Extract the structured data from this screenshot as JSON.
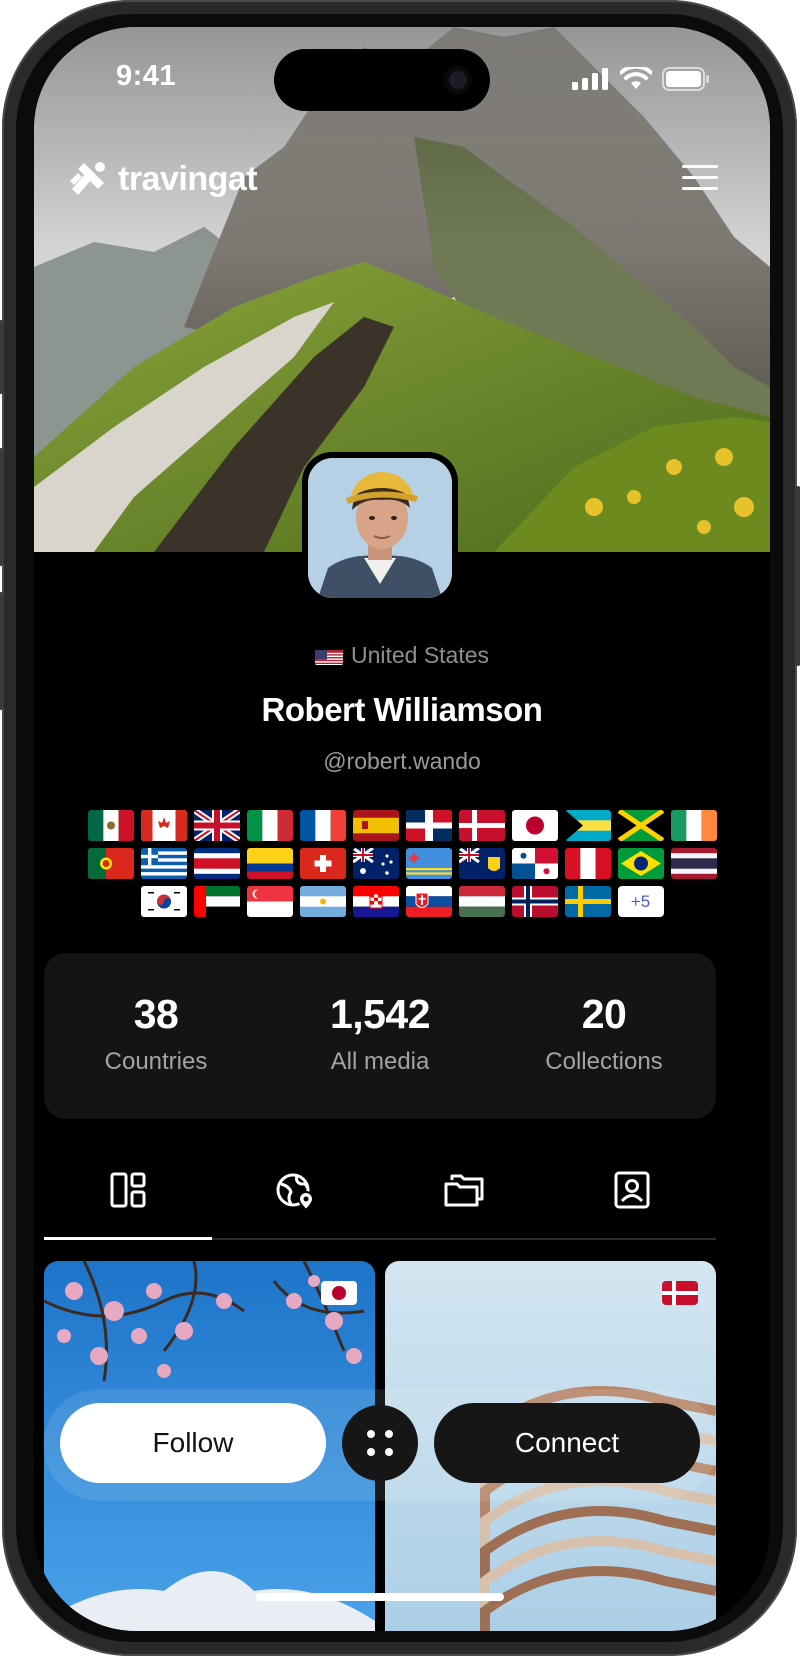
{
  "status_bar": {
    "time": "9:41"
  },
  "brand": {
    "name": "travingat"
  },
  "profile": {
    "country": "United States",
    "name": "Robert Williamson",
    "handle": "@robert.wando",
    "extra_flags": "+5"
  },
  "visited_flags": [
    "mexico",
    "canada",
    "united-kingdom",
    "italy",
    "france",
    "spain",
    "dominican-republic",
    "denmark",
    "japan",
    "bahamas",
    "jamaica",
    "ireland",
    "portugal",
    "greece",
    "costa-rica",
    "colombia",
    "switzerland",
    "australia",
    "aruba",
    "turks-and-caicos",
    "panama",
    "peru",
    "brazil",
    "thailand",
    "south-korea",
    "uae",
    "singapore",
    "argentina",
    "croatia",
    "slovakia",
    "hungary",
    "norway",
    "sweden"
  ],
  "stats": [
    {
      "value": "38",
      "label": "Countries"
    },
    {
      "value": "1,542",
      "label": "All media"
    },
    {
      "value": "20",
      "label": "Collections"
    }
  ],
  "tabs": [
    {
      "icon": "layout-icon",
      "active": true
    },
    {
      "icon": "globe-pin-icon",
      "active": false
    },
    {
      "icon": "folders-icon",
      "active": false
    },
    {
      "icon": "contact-icon",
      "active": false
    }
  ],
  "media": [
    {
      "country": "japan"
    },
    {
      "country": "denmark"
    }
  ],
  "actions": {
    "follow": "Follow",
    "connect": "Connect"
  },
  "colors": {
    "background": "#000000",
    "card": "#141414",
    "accent": "#ffffff"
  }
}
